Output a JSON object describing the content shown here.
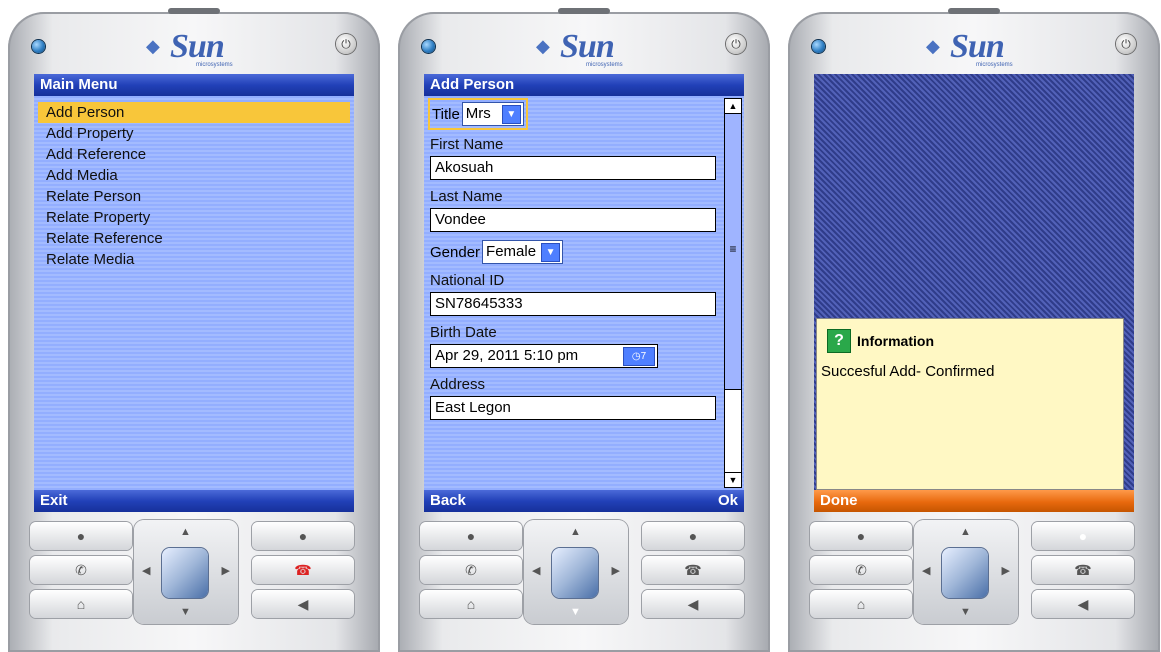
{
  "brand": {
    "name": "Sun",
    "sub": "microsystems"
  },
  "phone1": {
    "title": "Main Menu",
    "items": [
      "Add Person",
      "Add Property",
      "Add Reference",
      "Add Media",
      "Relate Person",
      "Relate Property",
      "Relate Reference",
      "Relate Media"
    ],
    "selected": "Add Person",
    "softkey_left": "Exit"
  },
  "phone2": {
    "title": "Add Person",
    "title_label": "Title",
    "title_value": "Mrs",
    "first_name_label": "First Name",
    "first_name_value": "Akosuah",
    "last_name_label": "Last Name",
    "last_name_value": "Vondee",
    "gender_label": "Gender",
    "gender_value": "Female",
    "national_id_label": "National ID",
    "national_id_value": "SN78645333",
    "birth_date_label": "Birth Date",
    "birth_date_value": "Apr 29, 2011 5:10 pm",
    "address_label": "Address",
    "address_value": "East Legon",
    "softkey_left": "Back",
    "softkey_right": "Ok"
  },
  "phone3": {
    "alert_title": "Information",
    "alert_message": "Succesful Add- Confirmed",
    "softkey_left": "Done"
  },
  "icons": [
    "power-icon",
    "up-arrow-icon",
    "down-arrow-icon",
    "left-arrow-icon",
    "right-arrow-icon",
    "call-icon",
    "end-call-icon",
    "home-icon",
    "back-icon",
    "calendar-icon",
    "question-icon"
  ],
  "colors": {
    "titlebar": "#2241b8",
    "form_bg": "#93aeff",
    "selection": "#f8c63a",
    "alert_bg": "#fff8c4",
    "alert_bar": "#e8690e"
  }
}
